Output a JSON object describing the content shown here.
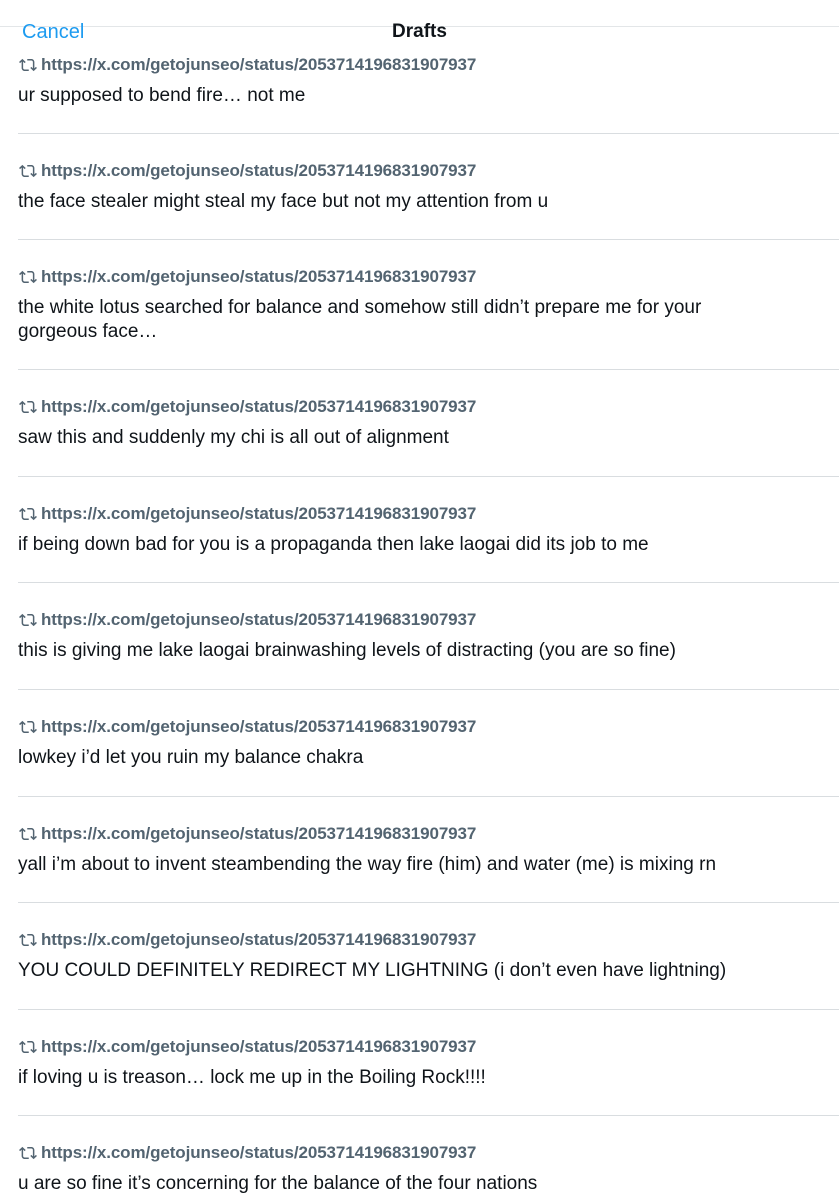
{
  "header": {
    "cancel_label": "Cancel",
    "title": "Drafts"
  },
  "drafts": [
    {
      "url": "https://x.com/getojunseo/status/2053714196831907937",
      "text": "ur supposed to bend fire… not me"
    },
    {
      "url": "https://x.com/getojunseo/status/2053714196831907937",
      "text": "the face stealer might steal my face but not my attention from u"
    },
    {
      "url": "https://x.com/getojunseo/status/2053714196831907937",
      "text": "the white lotus searched for balance and somehow still didn’t prepare me for your gorgeous face…"
    },
    {
      "url": "https://x.com/getojunseo/status/2053714196831907937",
      "text": "saw this and suddenly my chi is all out of alignment"
    },
    {
      "url": "https://x.com/getojunseo/status/2053714196831907937",
      "text": "if being down bad for you is a propaganda then lake laogai did its job to me"
    },
    {
      "url": "https://x.com/getojunseo/status/2053714196831907937",
      "text": "this is giving me lake laogai brainwashing levels of distracting (you are so fine)"
    },
    {
      "url": "https://x.com/getojunseo/status/2053714196831907937",
      "text": "lowkey i’d let you ruin my balance chakra"
    },
    {
      "url": "https://x.com/getojunseo/status/2053714196831907937",
      "text": "yall i’m about to invent steambending the way fire (him) and water (me) is mixing rn"
    },
    {
      "url": "https://x.com/getojunseo/status/2053714196831907937",
      "text": "YOU COULD DEFINITELY REDIRECT MY LIGHTNING (i don’t even have lightning)"
    },
    {
      "url": "https://x.com/getojunseo/status/2053714196831907937",
      "text": "if loving u is treason… lock me up in the Boiling Rock!!!!"
    },
    {
      "url": "https://x.com/getojunseo/status/2053714196831907937",
      "text": "u are so fine it’s concerning for the balance of the four nations"
    }
  ],
  "icons": {
    "retweet": "retweet-icon"
  },
  "colors": {
    "accent": "#1d9bf0",
    "secondary_text": "#536471",
    "primary_text": "#0f1419",
    "divider": "#d9dde0"
  }
}
